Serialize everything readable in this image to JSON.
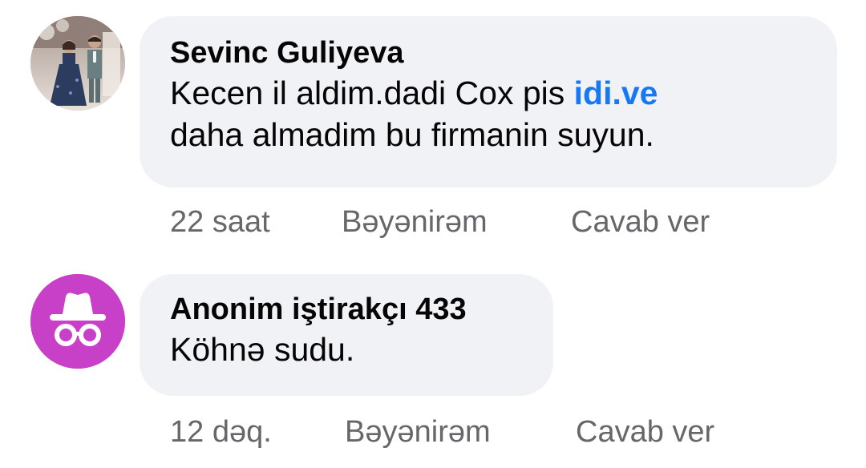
{
  "comments": [
    {
      "author": "Sevinc Guliyeva",
      "text_line1_before": "Kecen il aldim.dadi Cox pis ",
      "text_line1_link": "idi.ve",
      "text_line2": "daha almadim bu firmanin suyun.",
      "time": "22 saat",
      "like_label": "Bəyənirəm",
      "reply_label": "Cavab ver",
      "avatar": "photo-avatar"
    },
    {
      "author": "Anonim iştirakçı 433",
      "text_line1": "Köhnə sudu.",
      "time": "12 dəq.",
      "like_label": "Bəyənirəm",
      "reply_label": "Cavab ver",
      "avatar": "anonymous-incognito-icon",
      "avatar_color": "#c840c8"
    }
  ],
  "colors": {
    "bubble": "#f0f2f5",
    "link": "#1877f2",
    "meta": "#65676b"
  }
}
